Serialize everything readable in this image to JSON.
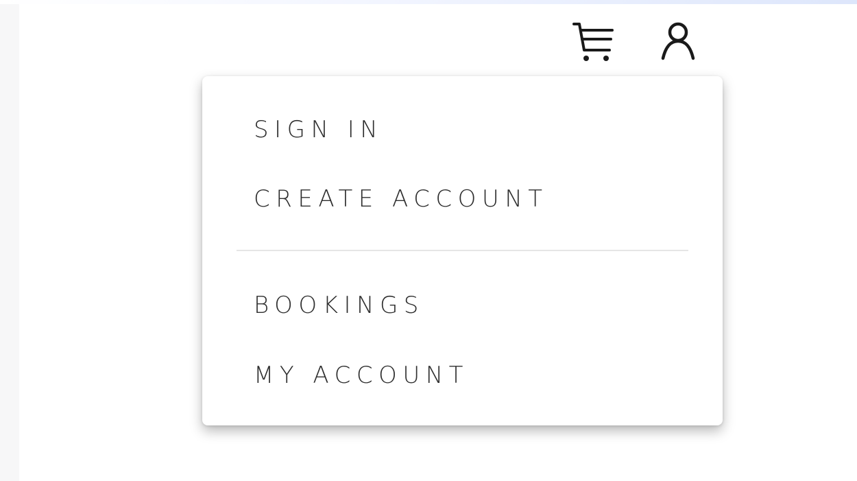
{
  "header": {
    "cart_icon": "shopping-cart-icon",
    "account_icon": "user-icon"
  },
  "account_menu": {
    "items_group_1": [
      {
        "label": "SIGN IN"
      },
      {
        "label": "CREATE ACCOUNT"
      }
    ],
    "items_group_2": [
      {
        "label": "BOOKINGS"
      },
      {
        "label": "MY ACCOUNT"
      }
    ]
  },
  "colors": {
    "text": "#2e2e2e",
    "icon": "#1a1a1a",
    "divider": "#e5e5e5",
    "menu_background": "#ffffff",
    "page_background": "#ffffff"
  }
}
